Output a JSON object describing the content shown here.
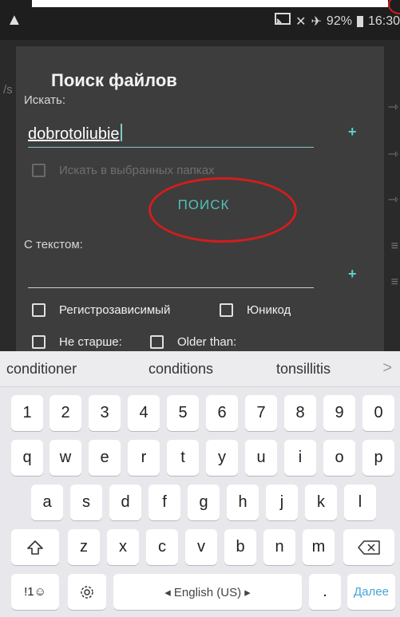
{
  "statusbar": {
    "battery": "92%",
    "time": "16:30"
  },
  "background": {
    "path_fragment": "/s"
  },
  "dialog": {
    "title": "Поиск файлов",
    "search_label": "Искать:",
    "search_value": "dobrotoliubie",
    "plus": "+",
    "in_selected_label": "Искать в выбранных папках",
    "search_button": "ПОИСК",
    "with_text_label": "С текстом:",
    "with_text_value": "",
    "case_sensitive_label": "Регистрозависимый",
    "unicode_label": "Юникод",
    "not_older_label": "Не старше:",
    "older_than_label": "Older than:"
  },
  "keyboard": {
    "suggestions": [
      "conditioner",
      "conditions",
      "tonsillitis"
    ],
    "suggest_more": ">",
    "row_numbers": [
      "1",
      "2",
      "3",
      "4",
      "5",
      "6",
      "7",
      "8",
      "9",
      "0"
    ],
    "row_top": [
      "q",
      "w",
      "e",
      "r",
      "t",
      "y",
      "u",
      "i",
      "o",
      "p"
    ],
    "row_mid": [
      "a",
      "s",
      "d",
      "f",
      "g",
      "h",
      "j",
      "k",
      "l"
    ],
    "row_bottom": [
      "z",
      "x",
      "c",
      "v",
      "b",
      "n",
      "m"
    ],
    "symbols_label": "!1☺",
    "space_label": "◂  English (US)  ▸",
    "period_label": ".",
    "action_label": "Далее"
  }
}
